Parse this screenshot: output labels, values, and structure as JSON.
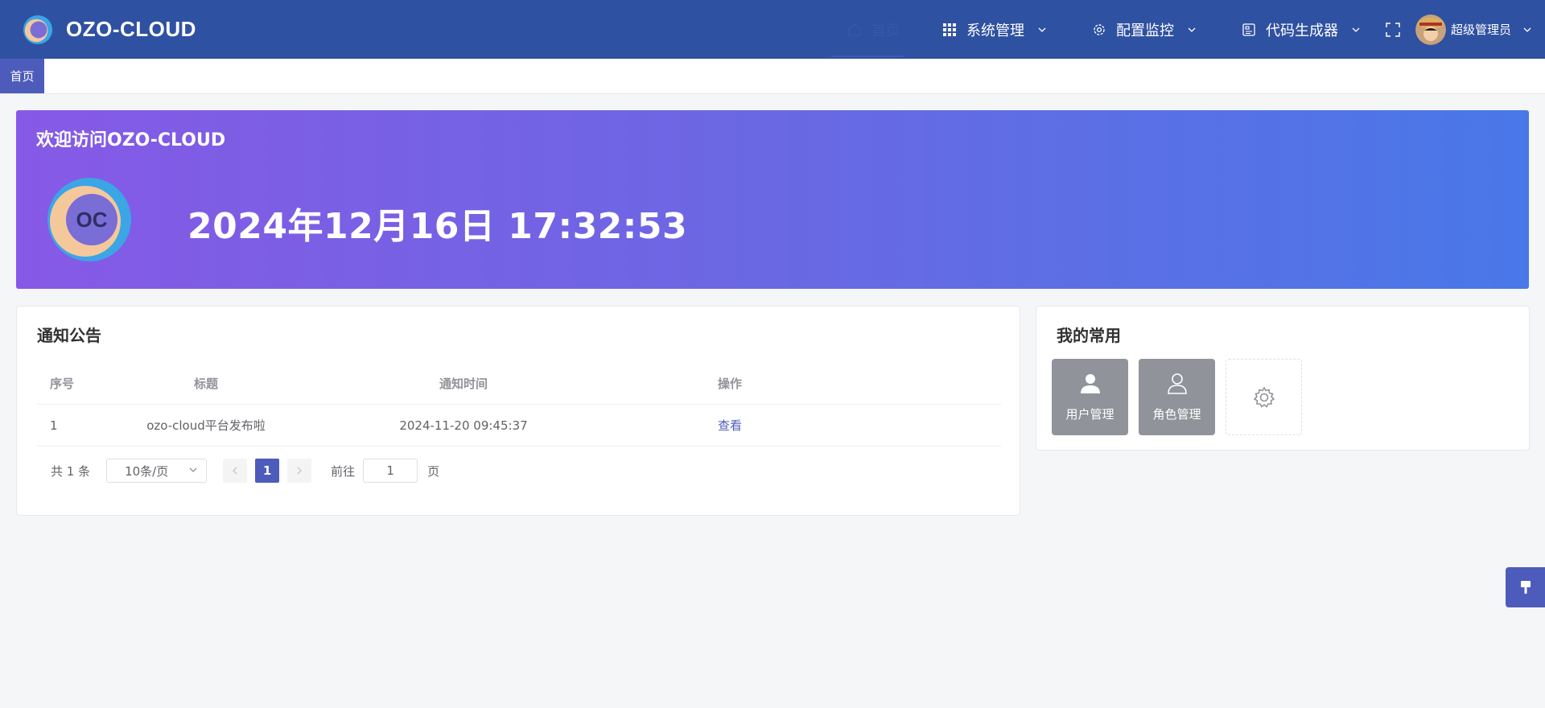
{
  "header": {
    "brand": "OZO-CLOUD",
    "nav": [
      {
        "label": "首页",
        "icon": "home-icon",
        "active": true
      },
      {
        "label": "系统管理",
        "icon": "grid-icon"
      },
      {
        "label": "配置监控",
        "icon": "gear-icon"
      },
      {
        "label": "代码生成器",
        "icon": "code-generator-icon"
      }
    ],
    "user": {
      "name": "超级管理员"
    }
  },
  "tabs": [
    {
      "label": "首页",
      "active": true
    }
  ],
  "banner": {
    "title": "欢迎访问OZO-CLOUD",
    "datetime": "2024年12月16日 17:32:53"
  },
  "notice": {
    "title": "通知公告",
    "columns": [
      "序号",
      "标题",
      "通知时间",
      "操作"
    ],
    "rows": [
      {
        "index": "1",
        "title": "ozo-cloud平台发布啦",
        "time": "2024-11-20 09:45:37",
        "action": "查看"
      }
    ],
    "pagination": {
      "total": "共 1 条",
      "page_size": "10条/页",
      "current_page": "1",
      "goto_prefix": "前往",
      "goto_value": "1",
      "goto_suffix": "页"
    }
  },
  "favorites": {
    "title": "我的常用",
    "items": [
      {
        "label": "用户管理",
        "icon": "user-filled-icon"
      },
      {
        "label": "角色管理",
        "icon": "user-outline-icon"
      }
    ],
    "add_icon": "gear-icon"
  },
  "colors": {
    "header_bg": "#2f51a1",
    "accent": "#4d5cbb",
    "banner_start": "#8659e6",
    "banner_end": "#4978e8",
    "fav_tile": "#909399"
  }
}
